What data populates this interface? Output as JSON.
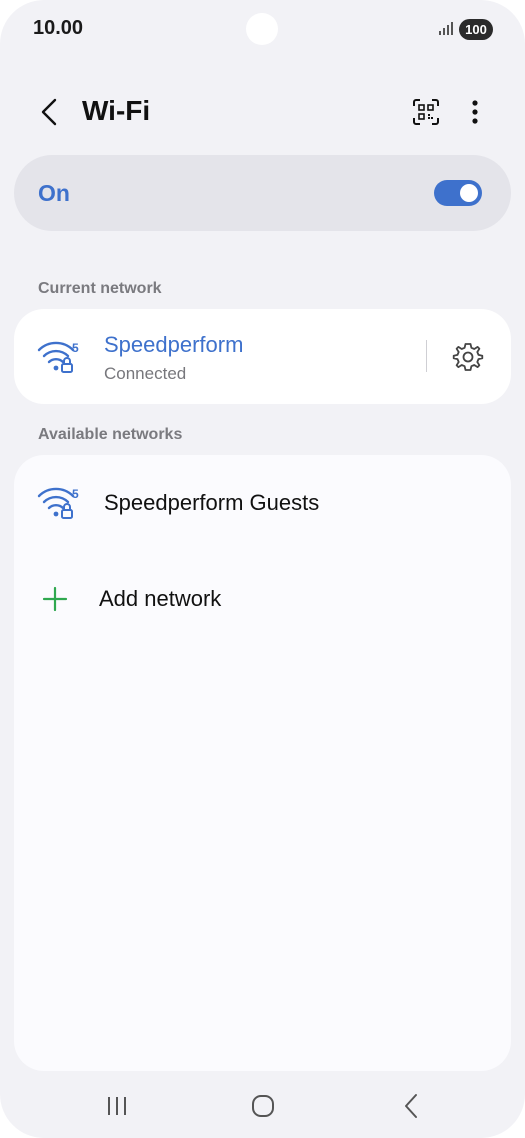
{
  "status_bar": {
    "time": "10.00",
    "battery": "100"
  },
  "header": {
    "title": "Wi-Fi",
    "back_icon": "chevron-left-icon",
    "qr_icon": "qr-scan-icon",
    "more_icon": "more-vertical-icon"
  },
  "wifi_toggle": {
    "label": "On",
    "state": true
  },
  "current_network": {
    "section_label": "Current network",
    "name": "Speedperform",
    "status": "Connected",
    "band": "5",
    "icon": "wifi-5ghz-locked-icon",
    "settings_icon": "gear-icon"
  },
  "available_networks": {
    "section_label": "Available networks",
    "items": [
      {
        "name": "Speedperform Guests",
        "band": "5",
        "icon": "wifi-5ghz-locked-icon"
      }
    ],
    "add_label": "Add network",
    "add_icon": "plus-icon"
  },
  "colors": {
    "accent": "#3e71cc",
    "background": "#f2f2f6",
    "add_icon": "#2fa84f"
  },
  "nav_bar": {
    "recents_icon": "recents-icon",
    "home_icon": "home-icon",
    "back_icon": "back-icon"
  }
}
